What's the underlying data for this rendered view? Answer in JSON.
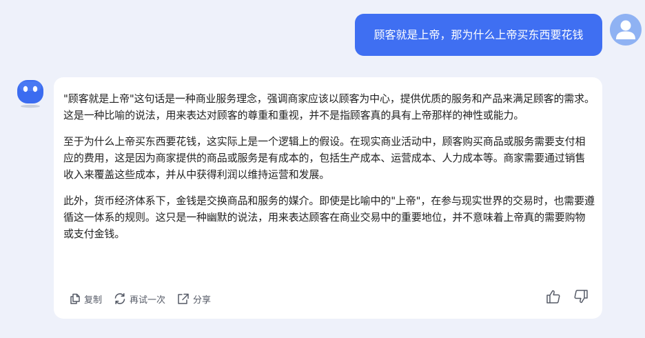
{
  "user": {
    "message": "顾客就是上帝，那为什么上帝买东西要花钱",
    "avatar_icon": "user-avatar-icon"
  },
  "assistant": {
    "avatar_icon": "robot-avatar-icon",
    "paragraphs": [
      "\"顾客就是上帝\"这句话是一种商业服务理念，强调商家应该以顾客为中心，提供优质的服务和产品来满足顾客的需求。这是一种比喻的说法，用来表达对顾客的尊重和重视，并不是指顾客真的具有上帝那样的神性或能力。",
      "至于为什么上帝买东西要花钱，这实际上是一个逻辑上的假设。在现实商业活动中，顾客购买商品或服务需要支付相应的费用，这是因为商家提供的商品或服务是有成本的，包括生产成本、运营成本、人力成本等。商家需要通过销售收入来覆盖这些成本，并从中获得利润以维持运营和发展。",
      "此外，货币经济体系下，金钱是交换商品和服务的媒介。即使是比喻中的\"上帝\"，在参与现实世界的交易时，也需要遵循这一体系的规则。这只是一种幽默的说法，用来表达顾客在商业交易中的重要地位，并不意味着上帝真的需要购物或支付金钱。"
    ],
    "actions": {
      "copy_label": "复制",
      "retry_label": "再试一次",
      "share_label": "分享"
    }
  },
  "colors": {
    "background": "#eef1fa",
    "user_bubble": "#3f6ff2",
    "card": "#ffffff",
    "text": "#222222",
    "action_text": "#555a66"
  }
}
